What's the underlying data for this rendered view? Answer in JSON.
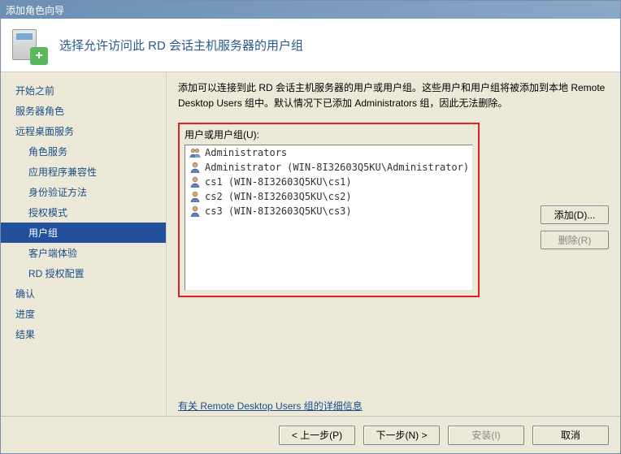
{
  "window": {
    "title": "添加角色向导"
  },
  "header": {
    "title": "选择允许访问此 RD 会话主机服务器的用户组"
  },
  "sidebar": {
    "items": [
      {
        "label": "开始之前",
        "sub": false,
        "selected": false
      },
      {
        "label": "服务器角色",
        "sub": false,
        "selected": false
      },
      {
        "label": "远程桌面服务",
        "sub": false,
        "selected": false
      },
      {
        "label": "角色服务",
        "sub": true,
        "selected": false
      },
      {
        "label": "应用程序兼容性",
        "sub": true,
        "selected": false
      },
      {
        "label": "身份验证方法",
        "sub": true,
        "selected": false
      },
      {
        "label": "授权模式",
        "sub": true,
        "selected": false
      },
      {
        "label": "用户组",
        "sub": true,
        "selected": true
      },
      {
        "label": "客户端体验",
        "sub": true,
        "selected": false
      },
      {
        "label": "RD 授权配置",
        "sub": true,
        "selected": false
      },
      {
        "label": "确认",
        "sub": false,
        "selected": false
      },
      {
        "label": "进度",
        "sub": false,
        "selected": false
      },
      {
        "label": "结果",
        "sub": false,
        "selected": false
      }
    ]
  },
  "content": {
    "description": "添加可以连接到此 RD 会话主机服务器的用户或用户组。这些用户和用户组将被添加到本地 Remote Desktop Users 组中。默认情况下已添加 Administrators 组，因此无法删除。",
    "list_label": "用户或用户组(U):",
    "items": [
      {
        "icon": "group",
        "label": "Administrators"
      },
      {
        "icon": "user",
        "label": "Administrator (WIN-8I32603Q5KU\\Administrator)"
      },
      {
        "icon": "user",
        "label": "cs1 (WIN-8I32603Q5KU\\cs1)"
      },
      {
        "icon": "user",
        "label": "cs2 (WIN-8I32603Q5KU\\cs2)"
      },
      {
        "icon": "user",
        "label": "cs3 (WIN-8I32603Q5KU\\cs3)"
      }
    ],
    "buttons": {
      "add": "添加(D)...",
      "remove": "删除(R)"
    },
    "link": "有关 Remote Desktop Users 组的详细信息"
  },
  "footer": {
    "prev": "< 上一步(P)",
    "next": "下一步(N) >",
    "install": "安装(I)",
    "cancel": "取消"
  }
}
